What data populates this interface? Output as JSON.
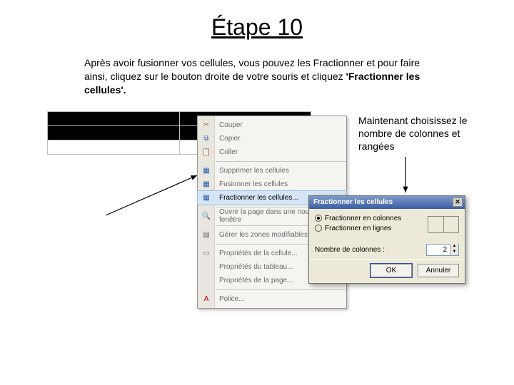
{
  "title": "Étape 10",
  "intro_before_bold": "Après avoir fusionner vos cellules, vous pouvez les Fractionner et pour faire ainsi, cliquez sur le bouton droite de votre souris et cliquez ",
  "intro_bold": "'Fractionner les cellules'.",
  "annotation": "Maintenant choisissez le nombre de colonnes et rangées",
  "context_menu": {
    "items": [
      {
        "label": "Couper"
      },
      {
        "label": "Copier"
      },
      {
        "label": "Coller"
      },
      {
        "sep": true
      },
      {
        "label": "Supprimer les cellules"
      },
      {
        "label": "Fusionner les cellules"
      },
      {
        "label": "Fractionner les cellules...",
        "selected": true
      },
      {
        "sep": true
      },
      {
        "label": "Ouvrir la page dans une nouvelle fenêtre"
      },
      {
        "sep": true
      },
      {
        "label": "Gérer les zones modifiables..."
      },
      {
        "sep": true
      },
      {
        "label": "Propriétés de la cellule..."
      },
      {
        "label": "Propriétés du tableau..."
      },
      {
        "label": "Propriétés de la page..."
      },
      {
        "sep": true
      },
      {
        "label": "Police..."
      }
    ]
  },
  "dialog": {
    "title": "Fractionner les cellules",
    "opt_cols": "Fractionner en colonnes",
    "opt_rows": "Fractionner en lignes",
    "ncols_label": "Nombre de colonnes :",
    "ncols_value": "2",
    "ok": "OK",
    "cancel": "Annuler"
  }
}
